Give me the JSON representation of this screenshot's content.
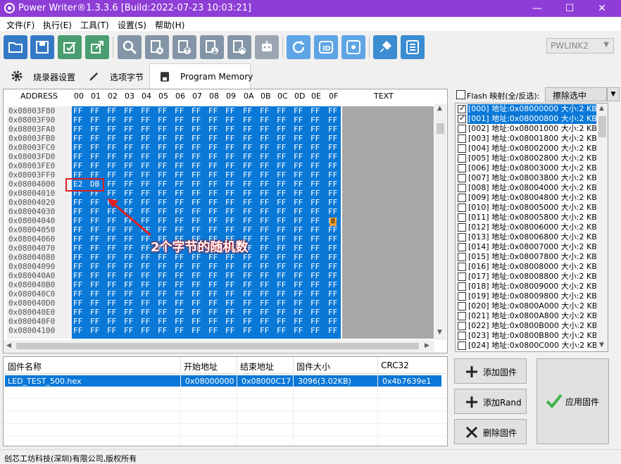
{
  "window": {
    "title": "Power Writer®1.3.3.6 [Build:2022-07-23 10:03:21]",
    "minimize": "—",
    "maximize": "☐",
    "close": "✕"
  },
  "menu": [
    "文件(F)",
    "执行(E)",
    "工具(T)",
    "设置(S)",
    "帮助(H)"
  ],
  "toolbar": {
    "buttons": [
      "open-folder",
      "save",
      "check-edit",
      "export",
      "search",
      "erase-chip",
      "upload",
      "download",
      "sync",
      "robot",
      "refresh",
      "id",
      "target",
      "connect-plug",
      "list-config"
    ],
    "device_select": "PWLINK2"
  },
  "tabs": [
    {
      "label": "烧录器设置",
      "icon": "gear-icon"
    },
    {
      "label": "选项字节",
      "icon": "edit-icon"
    },
    {
      "label": "Program Memory",
      "icon": "memory-icon"
    }
  ],
  "hex": {
    "address_header": "ADDRESS",
    "column_headers": [
      "00",
      "01",
      "02",
      "03",
      "04",
      "05",
      "06",
      "07",
      "08",
      "09",
      "0A",
      "0B",
      "0C",
      "0D",
      "0E",
      "0F"
    ],
    "text_header": "TEXT",
    "fill_byte": "FF",
    "rows": [
      {
        "addr": "0x08003F80",
        "bytes": []
      },
      {
        "addr": "0x08003F90",
        "bytes": []
      },
      {
        "addr": "0x08003FA0",
        "bytes": []
      },
      {
        "addr": "0x08003FB0",
        "bytes": []
      },
      {
        "addr": "0x08003FC0",
        "bytes": []
      },
      {
        "addr": "0x08003FD0",
        "bytes": []
      },
      {
        "addr": "0x08003FE0",
        "bytes": []
      },
      {
        "addr": "0x08003FF0",
        "bytes": []
      },
      {
        "addr": "0x08004000",
        "bytes": [
          "E2",
          "DB"
        ]
      },
      {
        "addr": "0x08004010",
        "bytes": []
      },
      {
        "addr": "0x08004020",
        "bytes": []
      },
      {
        "addr": "0x08004030",
        "bytes": []
      },
      {
        "addr": "0x08004040",
        "bytes": []
      },
      {
        "addr": "0x08004050",
        "bytes": []
      },
      {
        "addr": "0x08004060",
        "bytes": []
      },
      {
        "addr": "0x08004070",
        "bytes": []
      },
      {
        "addr": "0x08004080",
        "bytes": []
      },
      {
        "addr": "0x08004090",
        "bytes": []
      },
      {
        "addr": "0x080040A0",
        "bytes": []
      },
      {
        "addr": "0x080040B0",
        "bytes": []
      },
      {
        "addr": "0x080040C0",
        "bytes": []
      },
      {
        "addr": "0x080040D0",
        "bytes": []
      },
      {
        "addr": "0x080040E0",
        "bytes": []
      },
      {
        "addr": "0x080040F0",
        "bytes": []
      },
      {
        "addr": "0x08004100",
        "bytes": []
      }
    ],
    "annotation": "2个字节的随机数"
  },
  "flash": {
    "header_label": "Flash 映射(全/反选):",
    "erase_button": "擦除选中",
    "items": [
      {
        "text": "[000] 地址:0x08000000 大小:2 KB",
        "checked": true,
        "selected": true
      },
      {
        "text": "[001] 地址:0x08000800 大小:2 KB",
        "checked": true,
        "selected": true
      },
      {
        "text": "[002] 地址:0x08001000 大小:2 KB",
        "checked": false,
        "selected": false
      },
      {
        "text": "[003] 地址:0x08001800 大小:2 KB",
        "checked": false,
        "selected": false
      },
      {
        "text": "[004] 地址:0x08002000 大小:2 KB",
        "checked": false,
        "selected": false
      },
      {
        "text": "[005] 地址:0x08002800 大小:2 KB",
        "checked": false,
        "selected": false
      },
      {
        "text": "[006] 地址:0x08003000 大小:2 KB",
        "checked": false,
        "selected": false
      },
      {
        "text": "[007] 地址:0x08003800 大小:2 KB",
        "checked": false,
        "selected": false
      },
      {
        "text": "[008] 地址:0x08004000 大小:2 KB",
        "checked": false,
        "selected": false
      },
      {
        "text": "[009] 地址:0x08004800 大小:2 KB",
        "checked": false,
        "selected": false
      },
      {
        "text": "[010] 地址:0x08005000 大小:2 KB",
        "checked": false,
        "selected": false
      },
      {
        "text": "[011] 地址:0x08005800 大小:2 KB",
        "checked": false,
        "selected": false
      },
      {
        "text": "[012] 地址:0x08006000 大小:2 KB",
        "checked": false,
        "selected": false
      },
      {
        "text": "[013] 地址:0x08006800 大小:2 KB",
        "checked": false,
        "selected": false
      },
      {
        "text": "[014] 地址:0x08007000 大小:2 KB",
        "checked": false,
        "selected": false
      },
      {
        "text": "[015] 地址:0x08007800 大小:2 KB",
        "checked": false,
        "selected": false
      },
      {
        "text": "[016] 地址:0x08008000 大小:2 KB",
        "checked": false,
        "selected": false
      },
      {
        "text": "[017] 地址:0x08008800 大小:2 KB",
        "checked": false,
        "selected": false
      },
      {
        "text": "[018] 地址:0x08009000 大小:2 KB",
        "checked": false,
        "selected": false
      },
      {
        "text": "[019] 地址:0x08009800 大小:2 KB",
        "checked": false,
        "selected": false
      },
      {
        "text": "[020] 地址:0x0800A000 大小:2 KB",
        "checked": false,
        "selected": false
      },
      {
        "text": "[021] 地址:0x0800A800 大小:2 KB",
        "checked": false,
        "selected": false
      },
      {
        "text": "[022] 地址:0x0800B000 大小:2 KB",
        "checked": false,
        "selected": false
      },
      {
        "text": "[023] 地址:0x0800B800 大小:2 KB",
        "checked": false,
        "selected": false
      },
      {
        "text": "[024] 地址:0x0800C000 大小:2 KB",
        "checked": false,
        "selected": false
      }
    ]
  },
  "firmware": {
    "headers": [
      "固件名称",
      "开始地址",
      "结束地址",
      "固件大小",
      "CRC32"
    ],
    "rows": [
      [
        "LED_TEST_500.hex",
        "0x08000000",
        "0x08000C17",
        "3096(3.02KB)",
        "0x4b7639e1"
      ]
    ]
  },
  "actions": {
    "add_firmware": "添加固件",
    "add_rand": "添加Rand",
    "delete_firmware": "删除固件",
    "apply_firmware": "应用固件"
  },
  "status": "创芯工坊科技(深圳)有限公司,版权所有",
  "colors": {
    "titlebar": "#8e3dd6",
    "selection": "#0a78d7",
    "annotation": "#e02020"
  }
}
